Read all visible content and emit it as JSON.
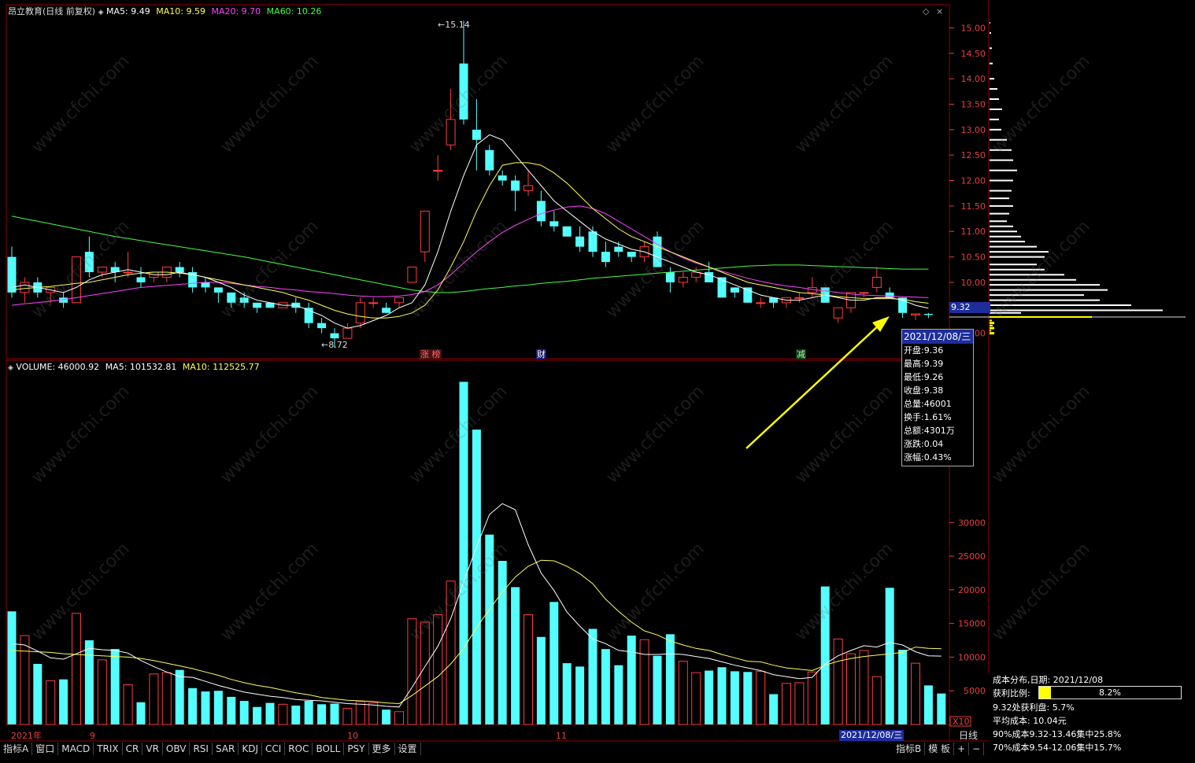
{
  "header": {
    "stock_name": "昂立教育(日线 前复权)",
    "ma5": "MA5: 9.49",
    "ma10": "MA10: 9.59",
    "ma20": "MA20: 9.70",
    "ma60": "MA60: 10.26"
  },
  "volume_header": {
    "volume": "VOLUME: 46000.92",
    "ma5": "MA5: 101532.81",
    "ma10": "MA10: 112525.77"
  },
  "price_axis": [
    "15.00",
    "14.50",
    "14.00",
    "13.50",
    "13.00",
    "12.50",
    "12.00",
    "11.50",
    "11.00",
    "10.50",
    "10.00",
    "9.32",
    "9.00"
  ],
  "volume_axis": [
    "30000",
    "25000",
    "20000",
    "15000",
    "10000",
    "5000",
    "X10"
  ],
  "current_price_label": "9.32",
  "high_annotation": "15.14",
  "low_annotation": "8.72",
  "event_markers": [
    "涨 榜",
    "财",
    "减"
  ],
  "x_axis": {
    "labels": [
      "2021年",
      "9",
      "10",
      "11"
    ],
    "selected_date": "2021/12/08/三",
    "period": "日线"
  },
  "tooltip": {
    "date": "2021/12/08/三",
    "rows": [
      "开盘:9.36",
      "最高:9.39",
      "最低:9.26",
      "收盘:9.38",
      "总量:46001",
      "换手:1.61%",
      "总额:4301万",
      "涨跌:0.04",
      "涨幅:0.43%"
    ]
  },
  "indicator_tabs": [
    "指标A",
    "窗口",
    "MACD",
    "TRIX",
    "CR",
    "VR",
    "OBV",
    "RSI",
    "SAR",
    "KDJ",
    "CCI",
    "ROC",
    "BOLL",
    "PSY",
    "更多",
    "设置"
  ],
  "right_tabs": [
    "指标B",
    "模 板",
    "+",
    "−"
  ],
  "cost_panel": {
    "title": "成本分布,日期: 2021/12/08",
    "profit_ratio_label": "获利比例:",
    "profit_ratio_value": "8.2%",
    "profit_ratio_fraction": 0.082,
    "profit_at": "9.32处获利盘: 5.7%",
    "avg_cost": "平均成本: 10.04元",
    "cost90": "90%成本9.32-13.46集中25.8%",
    "cost70": "70%成本9.54-12.06集中15.7%"
  },
  "watermark": "www.cfchi.com",
  "colors": {
    "up": "#ff3c3c",
    "down": "#54ffff",
    "ma5": "#ffffff",
    "ma10": "#ffff55",
    "ma20": "#ff44ff",
    "ma60": "#44ff44",
    "grid": "#8b0000",
    "selected": "#1e2d9c"
  },
  "chart_data": {
    "type": "candlestick",
    "ylim": [
      8.5,
      15.3
    ],
    "candles": [
      {
        "o": 10.5,
        "h": 10.7,
        "c": 9.8,
        "l": 9.7
      },
      {
        "o": 9.8,
        "h": 10.1,
        "c": 10.0,
        "l": 9.6
      },
      {
        "o": 10.0,
        "h": 10.1,
        "c": 9.8,
        "l": 9.7
      },
      {
        "o": 9.8,
        "h": 9.9,
        "c": 9.9,
        "l": 9.6
      },
      {
        "o": 9.7,
        "h": 9.8,
        "c": 9.6,
        "l": 9.5
      },
      {
        "o": 9.6,
        "h": 10.5,
        "c": 10.5,
        "l": 9.6
      },
      {
        "o": 10.6,
        "h": 10.9,
        "c": 10.2,
        "l": 10.1
      },
      {
        "o": 10.2,
        "h": 10.3,
        "c": 10.3,
        "l": 10.1
      },
      {
        "o": 10.3,
        "h": 10.4,
        "c": 10.2,
        "l": 10.0
      },
      {
        "o": 10.2,
        "h": 10.6,
        "c": 10.2,
        "l": 10.1
      },
      {
        "o": 10.1,
        "h": 10.3,
        "c": 10.0,
        "l": 9.9
      },
      {
        "o": 10.1,
        "h": 10.2,
        "c": 10.2,
        "l": 10.0
      },
      {
        "o": 10.1,
        "h": 10.3,
        "c": 10.3,
        "l": 10.0
      },
      {
        "o": 10.3,
        "h": 10.4,
        "c": 10.2,
        "l": 10.1
      },
      {
        "o": 10.2,
        "h": 10.3,
        "c": 9.9,
        "l": 9.8
      },
      {
        "o": 10.0,
        "h": 10.1,
        "c": 9.9,
        "l": 9.8
      },
      {
        "o": 9.9,
        "h": 9.9,
        "c": 9.8,
        "l": 9.6
      },
      {
        "o": 9.8,
        "h": 9.8,
        "c": 9.6,
        "l": 9.5
      },
      {
        "o": 9.7,
        "h": 9.8,
        "c": 9.6,
        "l": 9.5
      },
      {
        "o": 9.6,
        "h": 9.6,
        "c": 9.5,
        "l": 9.4
      },
      {
        "o": 9.6,
        "h": 9.6,
        "c": 9.5,
        "l": 9.5
      },
      {
        "o": 9.5,
        "h": 9.6,
        "c": 9.6,
        "l": 9.5
      },
      {
        "o": 9.6,
        "h": 9.7,
        "c": 9.5,
        "l": 9.4
      },
      {
        "o": 9.5,
        "h": 9.6,
        "c": 9.2,
        "l": 9.1
      },
      {
        "o": 9.2,
        "h": 9.3,
        "c": 9.1,
        "l": 9.0
      },
      {
        "o": 9.0,
        "h": 9.1,
        "c": 8.9,
        "l": 8.72
      },
      {
        "o": 8.9,
        "h": 9.2,
        "c": 9.1,
        "l": 8.9
      },
      {
        "o": 9.2,
        "h": 9.7,
        "c": 9.6,
        "l": 9.1
      },
      {
        "o": 9.6,
        "h": 9.7,
        "c": 9.6,
        "l": 9.5
      },
      {
        "o": 9.5,
        "h": 9.6,
        "c": 9.4,
        "l": 9.4
      },
      {
        "o": 9.6,
        "h": 9.7,
        "c": 9.7,
        "l": 9.5
      },
      {
        "o": 10.0,
        "h": 10.3,
        "c": 10.3,
        "l": 10.0
      },
      {
        "o": 10.6,
        "h": 11.4,
        "c": 11.4,
        "l": 10.4
      },
      {
        "o": 12.2,
        "h": 12.5,
        "c": 12.2,
        "l": 12.0
      },
      {
        "o": 12.7,
        "h": 13.8,
        "c": 13.2,
        "l": 12.6
      },
      {
        "o": 14.3,
        "h": 15.14,
        "c": 13.2,
        "l": 13.1
      },
      {
        "o": 13.0,
        "h": 13.6,
        "c": 12.8,
        "l": 12.2
      },
      {
        "o": 12.6,
        "h": 12.7,
        "c": 12.2,
        "l": 12.1
      },
      {
        "o": 12.1,
        "h": 12.2,
        "c": 12.0,
        "l": 11.9
      },
      {
        "o": 12.0,
        "h": 12.1,
        "c": 11.8,
        "l": 11.4
      },
      {
        "o": 11.8,
        "h": 12.2,
        "c": 11.9,
        "l": 11.7
      },
      {
        "o": 11.6,
        "h": 11.8,
        "c": 11.2,
        "l": 11.1
      },
      {
        "o": 11.2,
        "h": 11.4,
        "c": 11.1,
        "l": 11.0
      },
      {
        "o": 11.1,
        "h": 11.1,
        "c": 10.9,
        "l": 10.9
      },
      {
        "o": 10.9,
        "h": 11.1,
        "c": 10.7,
        "l": 10.6
      },
      {
        "o": 11.0,
        "h": 11.1,
        "c": 10.6,
        "l": 10.5
      },
      {
        "o": 10.6,
        "h": 10.8,
        "c": 10.4,
        "l": 10.3
      },
      {
        "o": 10.7,
        "h": 10.8,
        "c": 10.6,
        "l": 10.5
      },
      {
        "o": 10.6,
        "h": 10.6,
        "c": 10.5,
        "l": 10.4
      },
      {
        "o": 10.5,
        "h": 10.8,
        "c": 10.7,
        "l": 10.4
      },
      {
        "o": 10.9,
        "h": 11.0,
        "c": 10.3,
        "l": 10.3
      },
      {
        "o": 10.2,
        "h": 10.3,
        "c": 10.0,
        "l": 9.8
      },
      {
        "o": 10.0,
        "h": 10.2,
        "c": 10.1,
        "l": 9.9
      },
      {
        "o": 10.1,
        "h": 10.3,
        "c": 10.2,
        "l": 10.0
      },
      {
        "o": 10.2,
        "h": 10.4,
        "c": 10.0,
        "l": 10.0
      },
      {
        "o": 10.1,
        "h": 10.1,
        "c": 9.7,
        "l": 9.7
      },
      {
        "o": 9.9,
        "h": 9.9,
        "c": 9.8,
        "l": 9.7
      },
      {
        "o": 9.9,
        "h": 9.9,
        "c": 9.6,
        "l": 9.6
      },
      {
        "o": 9.6,
        "h": 9.7,
        "c": 9.6,
        "l": 9.5
      },
      {
        "o": 9.7,
        "h": 9.7,
        "c": 9.6,
        "l": 9.5
      },
      {
        "o": 9.6,
        "h": 9.7,
        "c": 9.7,
        "l": 9.5
      },
      {
        "o": 9.7,
        "h": 9.8,
        "c": 9.7,
        "l": 9.6
      },
      {
        "o": 9.8,
        "h": 10.1,
        "c": 9.9,
        "l": 9.7
      },
      {
        "o": 9.9,
        "h": 9.9,
        "c": 9.6,
        "l": 9.6
      },
      {
        "o": 9.3,
        "h": 9.5,
        "c": 9.5,
        "l": 9.2
      },
      {
        "o": 9.5,
        "h": 9.8,
        "c": 9.8,
        "l": 9.4
      },
      {
        "o": 9.8,
        "h": 9.8,
        "c": 9.8,
        "l": 9.7
      },
      {
        "o": 9.9,
        "h": 10.3,
        "c": 10.1,
        "l": 9.8
      },
      {
        "o": 9.8,
        "h": 9.9,
        "c": 9.7,
        "l": 9.7
      },
      {
        "o": 9.7,
        "h": 9.7,
        "c": 9.4,
        "l": 9.3
      },
      {
        "o": 9.36,
        "h": 9.39,
        "c": 9.38,
        "l": 9.26
      },
      {
        "o": 9.38,
        "h": 9.4,
        "c": 9.36,
        "l": 9.3
      }
    ],
    "ma5": [
      9.9,
      9.95,
      9.9,
      9.85,
      9.8,
      9.9,
      10.05,
      10.15,
      10.2,
      10.25,
      10.2,
      10.15,
      10.15,
      10.2,
      10.15,
      10.1,
      10.0,
      9.9,
      9.75,
      9.65,
      9.6,
      9.55,
      9.55,
      9.45,
      9.35,
      9.2,
      9.1,
      9.15,
      9.25,
      9.35,
      9.5,
      9.6,
      9.95,
      10.6,
      11.4,
      12.1,
      12.7,
      12.9,
      12.8,
      12.5,
      12.2,
      11.9,
      11.6,
      11.4,
      11.2,
      11.0,
      10.85,
      10.75,
      10.65,
      10.6,
      10.5,
      10.4,
      10.3,
      10.2,
      10.15,
      10.05,
      9.95,
      9.85,
      9.75,
      9.7,
      9.65,
      9.65,
      9.7,
      9.75,
      9.7,
      9.65,
      9.65,
      9.7,
      9.7,
      9.65,
      9.55,
      9.49
    ],
    "ma10": [
      9.85,
      9.88,
      9.9,
      9.92,
      9.95,
      9.98,
      10.0,
      10.05,
      10.1,
      10.15,
      10.18,
      10.2,
      10.2,
      10.18,
      10.15,
      10.1,
      10.05,
      10.0,
      9.95,
      9.9,
      9.85,
      9.8,
      9.72,
      9.65,
      9.55,
      9.45,
      9.38,
      9.33,
      9.3,
      9.3,
      9.33,
      9.4,
      9.55,
      9.85,
      10.3,
      10.8,
      11.4,
      11.9,
      12.3,
      12.35,
      12.35,
      12.3,
      12.15,
      11.95,
      11.7,
      11.45,
      11.25,
      11.05,
      10.9,
      10.8,
      10.7,
      10.6,
      10.5,
      10.4,
      10.3,
      10.2,
      10.1,
      10.0,
      9.95,
      9.9,
      9.85,
      9.8,
      9.78,
      9.75,
      9.72,
      9.7,
      9.68,
      9.68,
      9.68,
      9.67,
      9.62,
      9.59
    ],
    "ma20": [
      9.55,
      9.58,
      9.6,
      9.63,
      9.66,
      9.7,
      9.74,
      9.78,
      9.82,
      9.86,
      9.9,
      9.92,
      9.94,
      9.96,
      9.98,
      10.0,
      10.0,
      9.98,
      9.95,
      9.92,
      9.9,
      9.87,
      9.85,
      9.82,
      9.8,
      9.78,
      9.75,
      9.73,
      9.72,
      9.72,
      9.73,
      9.76,
      9.82,
      9.95,
      10.15,
      10.38,
      10.6,
      10.8,
      10.98,
      11.12,
      11.24,
      11.35,
      11.42,
      11.48,
      11.5,
      11.45,
      11.35,
      11.2,
      11.05,
      10.9,
      10.75,
      10.6,
      10.48,
      10.38,
      10.3,
      10.22,
      10.15,
      10.08,
      10.02,
      9.97,
      9.93,
      9.9,
      9.86,
      9.83,
      9.8,
      9.77,
      9.75,
      9.74,
      9.73,
      9.72,
      9.71,
      9.7
    ],
    "ma60": [
      11.3,
      11.25,
      11.2,
      11.15,
      11.1,
      11.05,
      11.0,
      10.95,
      10.9,
      10.86,
      10.82,
      10.78,
      10.74,
      10.7,
      10.66,
      10.62,
      10.58,
      10.54,
      10.5,
      10.45,
      10.4,
      10.35,
      10.3,
      10.25,
      10.2,
      10.15,
      10.1,
      10.05,
      10.0,
      9.95,
      9.9,
      9.85,
      9.82,
      9.8,
      9.8,
      9.82,
      9.85,
      9.88,
      9.9,
      9.93,
      9.95,
      9.98,
      10.0,
      10.02,
      10.05,
      10.08,
      10.1,
      10.12,
      10.14,
      10.16,
      10.18,
      10.2,
      10.22,
      10.24,
      10.26,
      10.28,
      10.3,
      10.32,
      10.33,
      10.34,
      10.34,
      10.34,
      10.33,
      10.32,
      10.31,
      10.3,
      10.29,
      10.28,
      10.27,
      10.26,
      10.26,
      10.26
    ],
    "volume": [
      16800,
      13200,
      9000,
      6500,
      6700,
      16500,
      12500,
      9600,
      11200,
      5900,
      3300,
      7500,
      7700,
      8100,
      5400,
      4900,
      5000,
      4100,
      3500,
      2600,
      3200,
      3000,
      2800,
      3500,
      3000,
      3100,
      2400,
      3400,
      3200,
      2200,
      1900,
      15700,
      15200,
      16300,
      21300,
      50900,
      43800,
      28200,
      24300,
      20400,
      16300,
      13000,
      18200,
      9100,
      8600,
      14200,
      11200,
      8800,
      13200,
      12600,
      10200,
      13400,
      9400,
      7700,
      8000,
      8500,
      7900,
      7800,
      7900,
      4500,
      6100,
      6200,
      7800,
      20500,
      12700,
      10500,
      11000,
      7100,
      20300,
      11100,
      9100,
      5800,
      4600
    ],
    "vol_ma5": [
      12000,
      11800,
      10900,
      9900,
      9700,
      10500,
      11300,
      11100,
      11000,
      10600,
      9500,
      8600,
      7800,
      7100,
      7000,
      6400,
      5800,
      5300,
      4800,
      4500,
      4200,
      4000,
      3700,
      3600,
      3500,
      3300,
      3100,
      3000,
      2900,
      2700,
      2600,
      5500,
      8600,
      11600,
      15700,
      21200,
      26400,
      31200,
      32800,
      31900,
      26700,
      22500,
      19900,
      16700,
      14600,
      12700,
      12000,
      11000,
      10800,
      10400,
      10400,
      10500,
      10400,
      10100,
      9800,
      9300,
      8800,
      8400,
      8000,
      7400,
      7100,
      6800,
      7000,
      9000,
      10200,
      11000,
      11700,
      11500,
      12200,
      11800,
      10800,
      10200,
      10150
    ],
    "vol_ma10": [
      11000,
      10900,
      10800,
      10700,
      10500,
      10400,
      10300,
      10200,
      10100,
      10000,
      9800,
      9500,
      9100,
      8700,
      8300,
      7800,
      7300,
      6700,
      6200,
      5800,
      5500,
      5100,
      4700,
      4400,
      4000,
      3800,
      3600,
      3500,
      3400,
      3200,
      3100,
      4300,
      5700,
      7100,
      9000,
      11300,
      14400,
      17100,
      19700,
      21900,
      23500,
      24400,
      24300,
      23500,
      22400,
      20900,
      18600,
      16800,
      15200,
      13900,
      13300,
      12400,
      11800,
      11300,
      11000,
      10400,
      9900,
      9400,
      9300,
      8800,
      8400,
      8200,
      8000,
      8800,
      9400,
      9800,
      10100,
      10300,
      10500,
      10700,
      11500,
      11300,
      11250
    ],
    "cost_distribution": [
      {
        "p": 9.05,
        "w": 2
      },
      {
        "p": 9.15,
        "w": 4
      },
      {
        "p": 9.25,
        "w": 3
      },
      {
        "p": 9.32,
        "w": 130
      },
      {
        "p": 9.4,
        "w": 40
      },
      {
        "p": 9.45,
        "w": 220
      },
      {
        "p": 9.55,
        "w": 180
      },
      {
        "p": 9.65,
        "w": 140
      },
      {
        "p": 9.75,
        "w": 120
      },
      {
        "p": 9.85,
        "w": 150
      },
      {
        "p": 9.95,
        "w": 140
      },
      {
        "p": 10.05,
        "w": 110
      },
      {
        "p": 10.15,
        "w": 95
      },
      {
        "p": 10.25,
        "w": 70
      },
      {
        "p": 10.35,
        "w": 60
      },
      {
        "p": 10.5,
        "w": 70
      },
      {
        "p": 10.6,
        "w": 75
      },
      {
        "p": 10.7,
        "w": 60
      },
      {
        "p": 10.8,
        "w": 45
      },
      {
        "p": 10.9,
        "w": 40
      },
      {
        "p": 11.0,
        "w": 35
      },
      {
        "p": 11.1,
        "w": 30
      },
      {
        "p": 11.2,
        "w": 22
      },
      {
        "p": 11.35,
        "w": 25
      },
      {
        "p": 11.5,
        "w": 30
      },
      {
        "p": 11.65,
        "w": 25
      },
      {
        "p": 11.8,
        "w": 28
      },
      {
        "p": 12.0,
        "w": 30
      },
      {
        "p": 12.2,
        "w": 35
      },
      {
        "p": 12.4,
        "w": 30
      },
      {
        "p": 12.6,
        "w": 28
      },
      {
        "p": 12.8,
        "w": 22
      },
      {
        "p": 13.0,
        "w": 15
      },
      {
        "p": 13.2,
        "w": 12
      },
      {
        "p": 13.4,
        "w": 16
      },
      {
        "p": 13.6,
        "w": 12
      },
      {
        "p": 13.8,
        "w": 10
      },
      {
        "p": 14.0,
        "w": 6
      },
      {
        "p": 14.3,
        "w": 4
      },
      {
        "p": 14.6,
        "w": 3
      },
      {
        "p": 14.9,
        "w": 2
      },
      {
        "p": 15.1,
        "w": 1
      }
    ]
  }
}
